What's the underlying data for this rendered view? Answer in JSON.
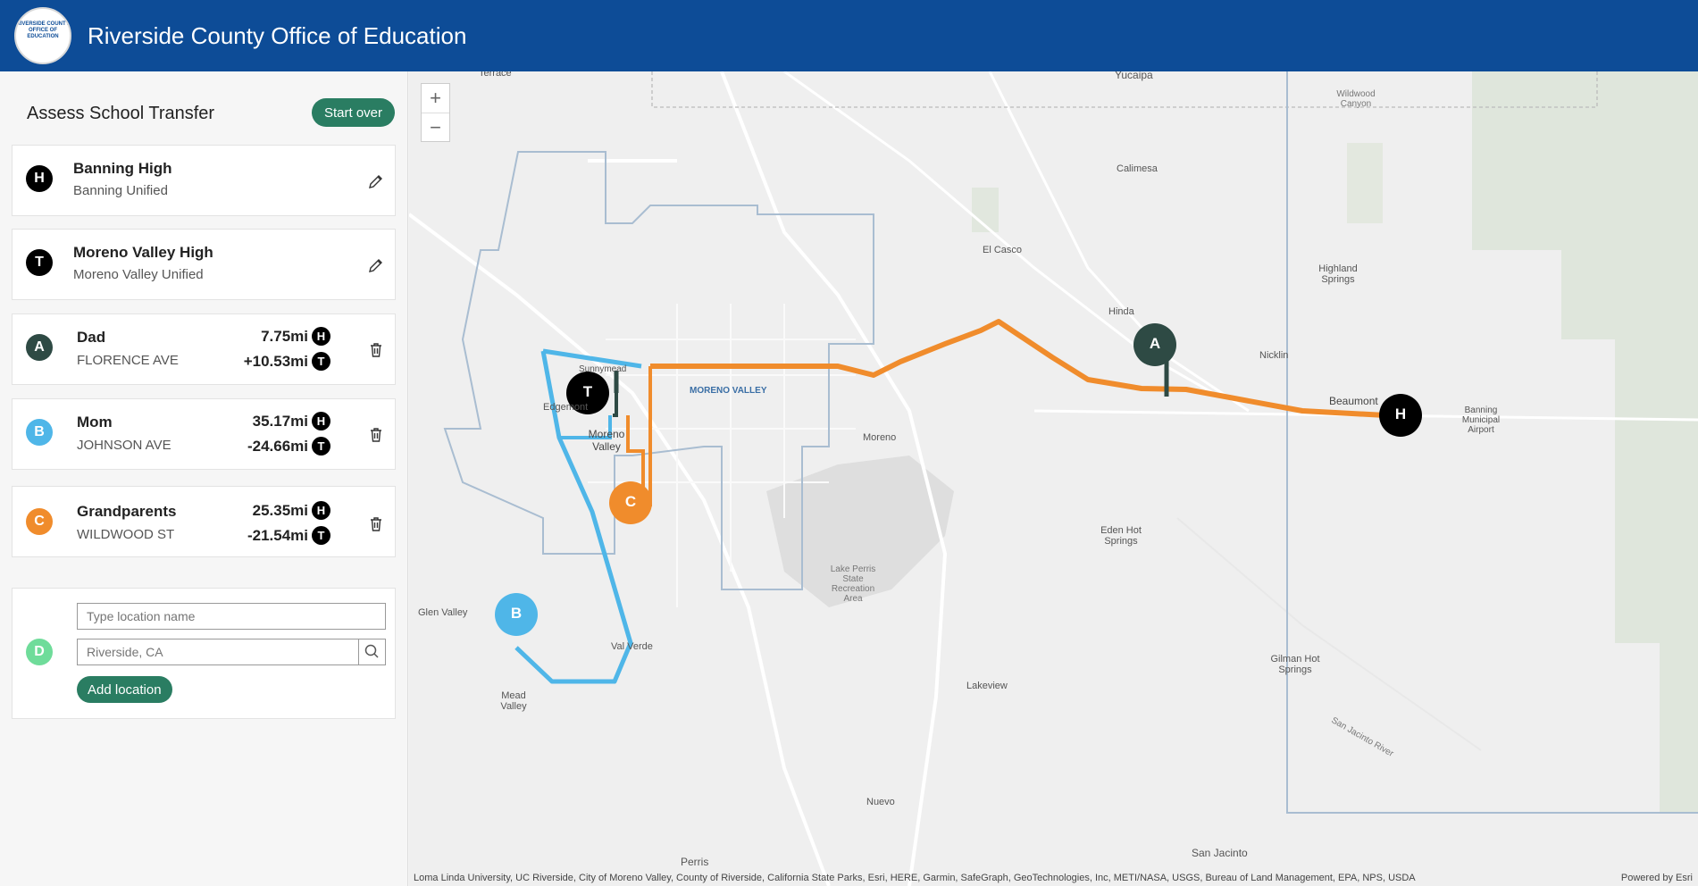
{
  "header": {
    "title": "Riverside County Office of Education",
    "logo_text": "RIVERSIDE COUNTY OFFICE OF EDUCATION"
  },
  "panel": {
    "title": "Assess School Transfer",
    "start_over": "Start over"
  },
  "schools": [
    {
      "badge": "H",
      "name": "Banning High",
      "district": "Banning Unified",
      "color": "#000000"
    },
    {
      "badge": "T",
      "name": "Moreno Valley High",
      "district": "Moreno Valley Unified",
      "color": "#000000"
    }
  ],
  "locations": [
    {
      "badge": "A",
      "name": "Dad",
      "street": "FLORENCE AVE",
      "dist_h": "7.75mi",
      "dist_t": "+10.53mi",
      "color": "#2e4a44"
    },
    {
      "badge": "B",
      "name": "Mom",
      "street": "JOHNSON AVE",
      "dist_h": "35.17mi",
      "dist_t": "-24.66mi",
      "color": "#4fb6e8"
    },
    {
      "badge": "C",
      "name": "Grandparents",
      "street": "WILDWOOD ST",
      "dist_h": "25.35mi",
      "dist_t": "-21.54mi",
      "color": "#f08c2c"
    }
  ],
  "new_location": {
    "badge": "D",
    "name_placeholder": "Type location name",
    "address_placeholder": "Riverside, CA",
    "add_label": "Add location",
    "color": "#6fdc9a"
  },
  "map": {
    "places": [
      "Terrace",
      "Yucaipa",
      "Wildwood Canyon",
      "Calimesa",
      "El Casco",
      "Highland Springs",
      "Hinda",
      "Nicklin",
      "Beaumont",
      "Banning Municipal Airport",
      "Sunnymead",
      "MORENO VALLEY",
      "Edgemont",
      "Moreno Valley",
      "Moreno",
      "Eden Hot Springs",
      "Lake Perris State Recreation Area",
      "Glen Valley",
      "Val Verde",
      "Mead Valley",
      "Lakeview",
      "Gilman Hot Springs",
      "San Jacinto River",
      "Nuevo",
      "Perris",
      "San Jacinto"
    ],
    "zoom_in": "+",
    "zoom_out": "−",
    "markers": {
      "A": "A",
      "B": "B",
      "C": "C",
      "T": "T",
      "H": "H"
    }
  },
  "attribution": "Loma Linda University, UC Riverside, City of Moreno Valley, County of Riverside, California State Parks, Esri, HERE, Garmin, SafeGraph, GeoTechnologies, Inc, METI/NASA, USGS, Bureau of Land Management, EPA, NPS, USDA",
  "powered_by": "Powered by Esri",
  "colors": {
    "header": "#0d4c97",
    "button": "#2a7d62",
    "route_a": "#2e4a44",
    "route_b": "#4fb6e8",
    "route_c": "#f08c2c"
  }
}
